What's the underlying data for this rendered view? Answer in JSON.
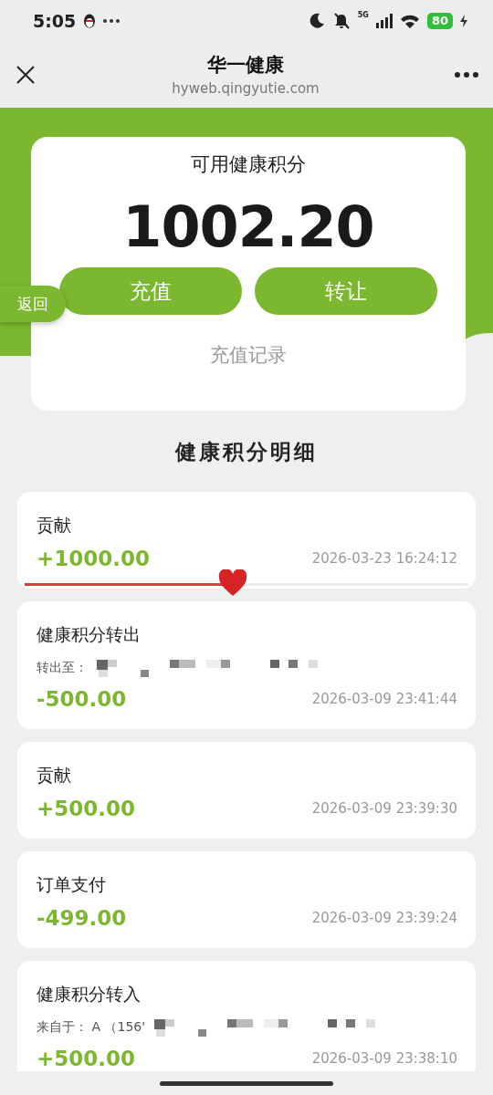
{
  "status_bar": {
    "time": "5:05",
    "network": "5G",
    "battery": "80"
  },
  "nav": {
    "title": "华一健康",
    "url": "hyweb.qingyutie.com"
  },
  "balance": {
    "label": "可用健康积分",
    "value": "1002.20",
    "buttons": [
      "充值",
      "转让"
    ],
    "link": "充值记录"
  },
  "back_tab": "返回",
  "section_title": "健康积分明细",
  "records": [
    {
      "title": "贡献",
      "amount": "+1000.00",
      "time": "2026-03-23 16:24:12",
      "progress": {
        "level": 0.47
      }
    },
    {
      "title": "健康积分转出",
      "detail": "转出至：",
      "amount": "-500.00",
      "time": "2026-03-09 23:41:44"
    },
    {
      "title": "贡献",
      "amount": "+500.00",
      "time": "2026-03-09 23:39:30"
    },
    {
      "title": "订单支付",
      "amount": "-499.00",
      "time": "2026-03-09 23:39:24"
    },
    {
      "title": "健康积分转入",
      "detail": "来自于： A （156'",
      "amount": "+500.00",
      "time": "2026-03-09 23:38:10"
    }
  ]
}
